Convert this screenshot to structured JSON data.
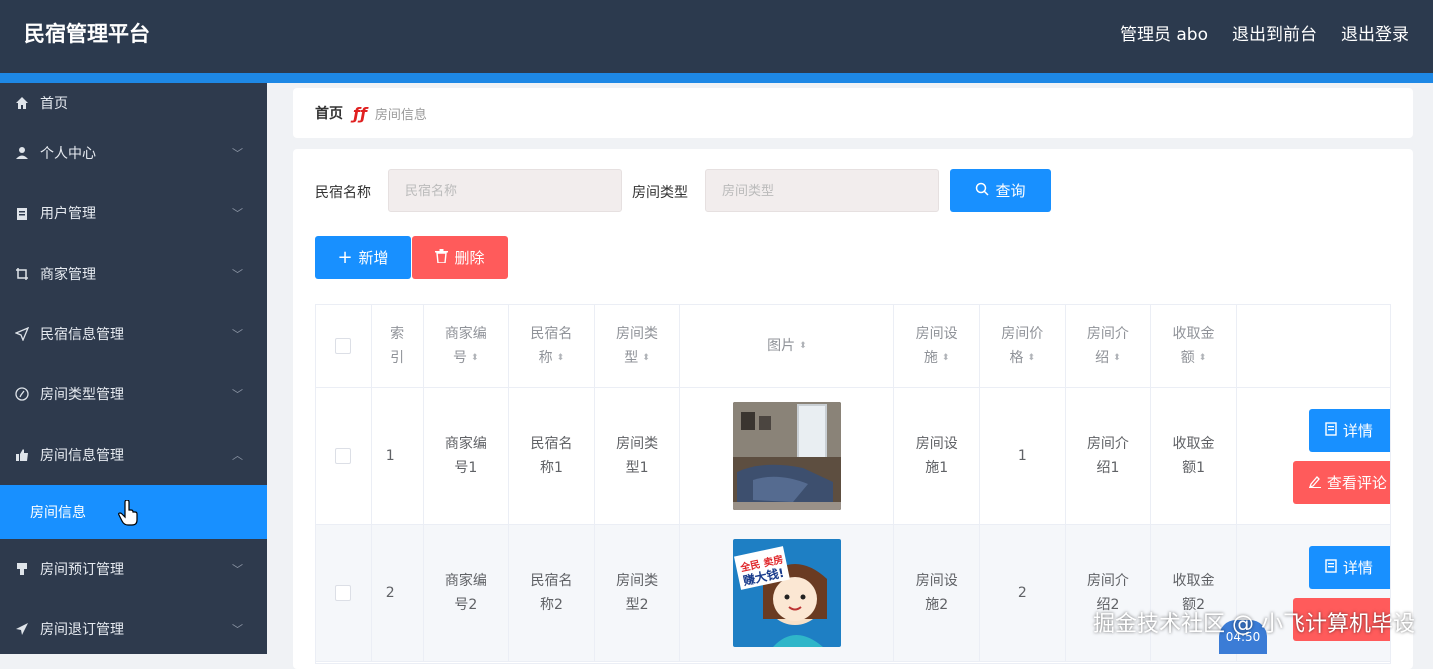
{
  "header": {
    "title": "民宿管理平台",
    "admin": "管理员 abo",
    "front": "退出到前台",
    "logout": "退出登录"
  },
  "sidebar": {
    "items": [
      {
        "label": "首页"
      },
      {
        "label": "个人中心"
      },
      {
        "label": "用户管理"
      },
      {
        "label": "商家管理"
      },
      {
        "label": "民宿信息管理"
      },
      {
        "label": "房间类型管理"
      },
      {
        "label": "房间信息管理"
      },
      {
        "label": "房间预订管理"
      },
      {
        "label": "房间退订管理"
      }
    ],
    "active_sub": "房间信息"
  },
  "breadcrumb": {
    "home": "首页",
    "current": "房间信息"
  },
  "filters": {
    "name_label": "民宿名称",
    "name_placeholder": "民宿名称",
    "type_label": "房间类型",
    "type_placeholder": "房间类型",
    "search": "查询"
  },
  "actions": {
    "add": "新增",
    "delete": "删除"
  },
  "table": {
    "headers": {
      "index": [
        "索",
        "引"
      ],
      "merchant": [
        "商家编",
        "号"
      ],
      "name": [
        "民宿名",
        "称"
      ],
      "type": [
        "房间类",
        "型"
      ],
      "image": "图片",
      "facility": [
        "房间设",
        "施"
      ],
      "price": [
        "房间价",
        "格"
      ],
      "intro": [
        "房间介",
        "绍"
      ],
      "fee": [
        "收取金",
        "额"
      ]
    },
    "rows": [
      {
        "index": "1",
        "merchant": [
          "商家编",
          "号1"
        ],
        "name": [
          "民宿名",
          "称1"
        ],
        "type": [
          "房间类",
          "型1"
        ],
        "facility": [
          "房间设",
          "施1"
        ],
        "price": "1",
        "intro": [
          "房间介",
          "绍1"
        ],
        "fee": [
          "收取金",
          "额1"
        ],
        "detail": "详情",
        "review": "查看评论"
      },
      {
        "index": "2",
        "merchant": [
          "商家编",
          "号2"
        ],
        "name": [
          "民宿名",
          "称2"
        ],
        "type": [
          "房间类",
          "型2"
        ],
        "facility": [
          "房间设",
          "施2"
        ],
        "price": "2",
        "intro": [
          "房间介",
          "绍2"
        ],
        "fee": [
          "收取金",
          "额2"
        ],
        "detail": "详情",
        "review": "",
        "poster": [
          "全民 卖房",
          "赚大钱!"
        ]
      }
    ]
  },
  "overlay": {
    "watermark": "掘金技术社区 @ 小飞计算机毕设",
    "time": "04:50"
  },
  "colors": {
    "header_bg": "#2c3a4e",
    "sidebar_bg": "#2e3a4d",
    "accent": "#1890ff",
    "danger": "#ff5b5b"
  }
}
